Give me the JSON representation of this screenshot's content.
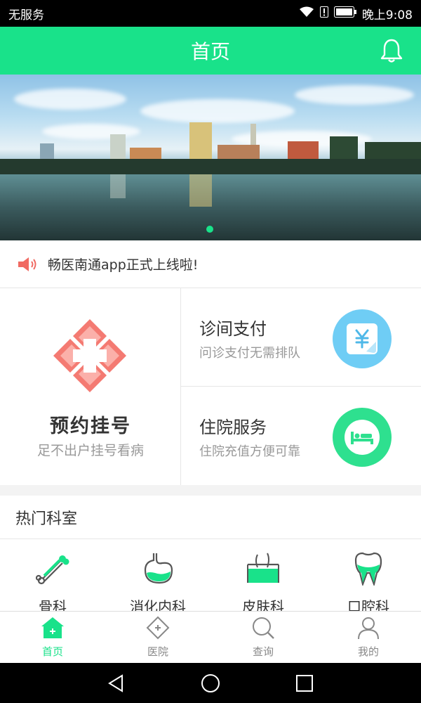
{
  "status_bar": {
    "carrier": "无服务",
    "time": "晚上9:08"
  },
  "header": {
    "title": "首页",
    "bell_icon": "bell-icon"
  },
  "banner": {
    "page_indicator": {
      "current": 1,
      "total": 1
    }
  },
  "notice": {
    "icon": "speaker-icon",
    "text": "畅医南通app正式上线啦!"
  },
  "services": {
    "appointment": {
      "title": "预约挂号",
      "subtitle": "足不出户挂号看病",
      "icon": "medical-cross-flower-icon"
    },
    "clinic_payment": {
      "title": "诊间支付",
      "subtitle": "问诊支付无需排队",
      "icon": "yuan-payment-icon"
    },
    "inpatient": {
      "title": "住院服务",
      "subtitle": "住院充值方便可靠",
      "icon": "hospital-bed-icon"
    }
  },
  "departments": {
    "title": "热门科室",
    "items": [
      {
        "label": "骨科",
        "icon": "bone-icon"
      },
      {
        "label": "消化内科",
        "icon": "stomach-icon"
      },
      {
        "label": "皮肤科",
        "icon": "skin-icon"
      },
      {
        "label": "口腔科",
        "icon": "tooth-icon"
      }
    ]
  },
  "tabbar": {
    "items": [
      {
        "label": "首页",
        "icon": "home-icon",
        "active": true
      },
      {
        "label": "医院",
        "icon": "hospital-icon",
        "active": false
      },
      {
        "label": "查询",
        "icon": "search-icon",
        "active": false
      },
      {
        "label": "我的",
        "icon": "user-icon",
        "active": false
      }
    ]
  },
  "colors": {
    "accent": "#19e28a",
    "notice_red": "#f06a62",
    "payment_blue": "#4fc3f7"
  }
}
